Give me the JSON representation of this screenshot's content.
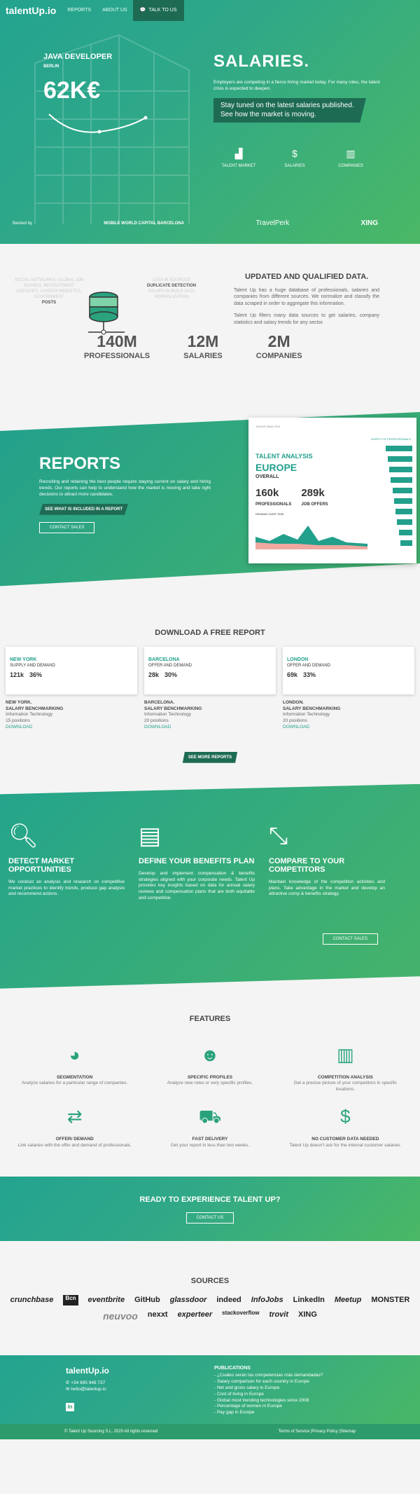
{
  "nav": {
    "logo": "talentUp.io",
    "reports": "REPORTS",
    "about": "ABOUT US",
    "talk": "TALK TO US"
  },
  "hero": {
    "role": "JAVA DEVELOPER",
    "city": "BERLIN",
    "salary": "62K€",
    "title": "SALARIES.",
    "intro": "Employers are competing in a fierce hiring market today. For many roles, the talent crisis is expected to deepen.",
    "band": "Stay tuned on the latest salaries published. See how the market is moving.",
    "icons": [
      {
        "label": "TALENT MARKET",
        "icon": "bar-chart-icon"
      },
      {
        "label": "SALARIES",
        "icon": "dollar-icon"
      },
      {
        "label": "COMPANIES",
        "icon": "building-icon"
      }
    ],
    "backed": "Backed by",
    "sponsors": [
      "MOBILE WORLD CAPITAL BARCELONA",
      "TravelPerk",
      "XING"
    ]
  },
  "data": {
    "left_faded": "SOCIAL NETWORKS, GLOBAL JOB BOARDS, RECRUITMENT AGENCIES, CAREER WEBSITES, GOVERNMENT",
    "left_strong": "POSTS",
    "mid_faded": "DATA IN SOURCES",
    "mid_strong": "DUPLICATE DETECTION",
    "mid_faded2": "SALARY IN BUILD DATA NORMALIZATION",
    "title": "UPDATED AND QUALIFIED DATA.",
    "p1": "Talent Up has a huge database of professionals, salaries and companies from different sources. We normalize and classify the data scraped in order to aggregate this information.",
    "p2": "Talent Up filters many data sources to get salaries, company statistics and salary trends for any sector.",
    "stats": [
      {
        "n": "140M",
        "l": "PROFESSIONALS"
      },
      {
        "n": "12M",
        "l": "SALARIES"
      },
      {
        "n": "2M",
        "l": "COMPANIES"
      }
    ]
  },
  "reports": {
    "title": "REPORTS",
    "text": "Recruiting and retaining the best people require staying current on salary and hiring trends. Our reports can help to understand how the market is moving and take right decisions to attract more candidates.",
    "btn1": "SEE WHAT IS INCLUDED IN A REPORT",
    "btn2": "CONTACT SALES",
    "card": {
      "head": "TALENT ANALYSIS",
      "t1": "TALENT ANALYSIS",
      "t2": "EUROPE",
      "t3": "OVERALL",
      "n1": "160k",
      "l1": "PROFESSIONALS",
      "n2": "289k",
      "l2": "JOB OFFERS",
      "chart": "DEMAND OVER TIME",
      "side": "SUPPLY OF PROFESSIONALS"
    }
  },
  "free": {
    "title": "DOWNLOAD A FREE REPORT",
    "see": "SEE MORE REPORTS",
    "dl": "DOWNLOAD",
    "cards": [
      {
        "city": "NEW YORK",
        "sub": "SUPPLY AND DEMAND",
        "a": "121k",
        "b": "36%",
        "l1": "NEW YORK.",
        "l2": "SALARY BENCHMARKING",
        "l3": "Information Technology",
        "l4": "15 positions"
      },
      {
        "city": "BARCELONA",
        "sub": "OFFER AND DEMAND",
        "a": "28k",
        "b": "30%",
        "l1": "BARCELONA.",
        "l2": "SALARY BENCHMARKING",
        "l3": "Information Technology",
        "l4": "20 positions"
      },
      {
        "city": "LONDON",
        "sub": "OFFER AND DEMAND",
        "a": "69k",
        "b": "33%",
        "l1": "LONDON.",
        "l2": "SALARY BENCHMARKING",
        "l3": "Information Technology",
        "l4": "20 positions"
      }
    ]
  },
  "benefits": [
    {
      "title": "DETECT MARKET OPPORTUNITIES",
      "text": "We conduct an analysis and research on competitive market practices to identify trends, produce gap analysis and recommend actions."
    },
    {
      "title": "DEFINE YOUR BENEFITS PLAN",
      "text": "Develop and implement compensation & benefits strategies aligned with your corporate needs. Talent Up provides key insights based on data for annual salary reviews and compensation plans that are both equitable and competitive."
    },
    {
      "title": "COMPARE TO YOUR COMPETITORS",
      "text": "Maintain knowledge of the competition activities and plans. Take advantage in the market and develop an attractive comp & benefits strategy."
    }
  ],
  "benefits_btn": "CONTACT SALES",
  "features": {
    "title": "FEATURES",
    "items": [
      {
        "t": "SEGMENTATION",
        "d": "Analyze salaries for a particular range of companies."
      },
      {
        "t": "SPECIFIC PROFILES",
        "d": "Analyze new roles or very specific profiles."
      },
      {
        "t": "COMPETITION ANALYSIS",
        "d": "Get a precise picture of your competitors in specific locations."
      },
      {
        "t": "OFFER/ DEMAND",
        "d": "Link salaries with the offer and demand of professionals."
      },
      {
        "t": "FAST DELIVERY",
        "d": "Get your report in less than two weeks."
      },
      {
        "t": "NO CUSTOMER DATA NEEDED",
        "d": "Talent Up doesn't ask for the internal customer salaries."
      }
    ]
  },
  "cta": {
    "title": "READY TO EXPERIENCE TALENT UP?",
    "btn": "CONTACT US"
  },
  "sources": {
    "title": "SOURCES",
    "logos": [
      "crunchbase",
      "Bcn",
      "eventbrite",
      "GitHub",
      "glassdoor",
      "indeed",
      "InfoJobs",
      "LinkedIn",
      "Meetup",
      "MONSTER",
      "neuvoo",
      "nexxt",
      "experteer",
      "stackoverflow",
      "trovit",
      "XING"
    ]
  },
  "footer": {
    "logo": "talentUp.io",
    "phone": "+34 695 948 737",
    "email": "hello@talentup.io",
    "pub_title": "PUBLICATIONS",
    "pubs": [
      "- ¿Cuales serán las competencias más demandadas?",
      "- Salary comparison for each country in Europe",
      "- Net and gross salary in Europe",
      "- Cost of living in Europe",
      "- Global most trending technologies since 2008",
      "- Percentage of women in Europe",
      "- Pay gap in Europe"
    ],
    "copy": "© Talent Up Sourcing S.L. 2020 All rights reserved",
    "legal": "Terms of Service |Privacy Policy |Sitemap"
  }
}
